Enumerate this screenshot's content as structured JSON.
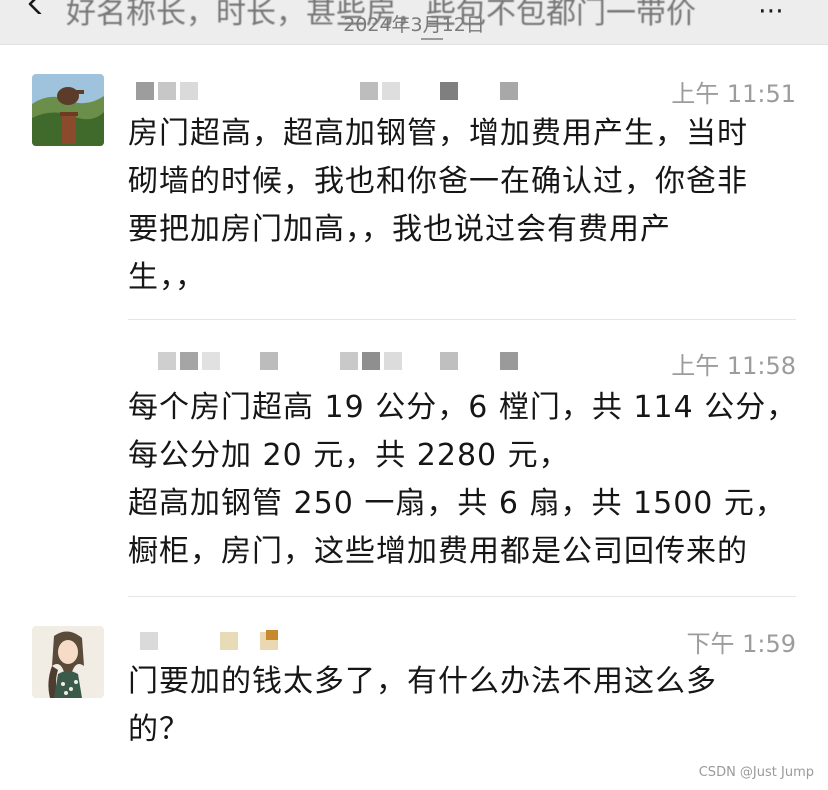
{
  "header": {
    "title": "好名称长，时长，甚些房，些包不包都门一带价",
    "date": "2024年3月12日"
  },
  "messages": [
    {
      "time": "上午 11:51",
      "lines": [
        "房门超高，超高加钢管，增加费用产生，当时",
        "砌墙的时候，我也和你爸一在确认过，你爸非",
        "要把加房门加高，，我也说过会有费用产",
        "生，，"
      ]
    },
    {
      "time": "上午 11:58",
      "lines": [
        "每个房门超高 19 公分，6 樘门，共 114 公分，",
        "每公分加 20 元，共 2280 元，",
        "超高加钢管 250 一扇，共 6 扇，共 1500 元，",
        "橱柜，房门，这些增加费用都是公司回传来的"
      ]
    },
    {
      "time": "下午 1:59",
      "lines": [
        "门要加的钱太多了，有什么办法不用这么多",
        "的？"
      ]
    }
  ],
  "watermark": "CSDN @Just Jump",
  "colors": {
    "topbar_bg": "#ededed",
    "time_text": "#9c9c9c",
    "body_text": "#161616",
    "divider": "#e6e6e6"
  },
  "icons": [
    "back-chevron-icon",
    "more-options-icon"
  ]
}
